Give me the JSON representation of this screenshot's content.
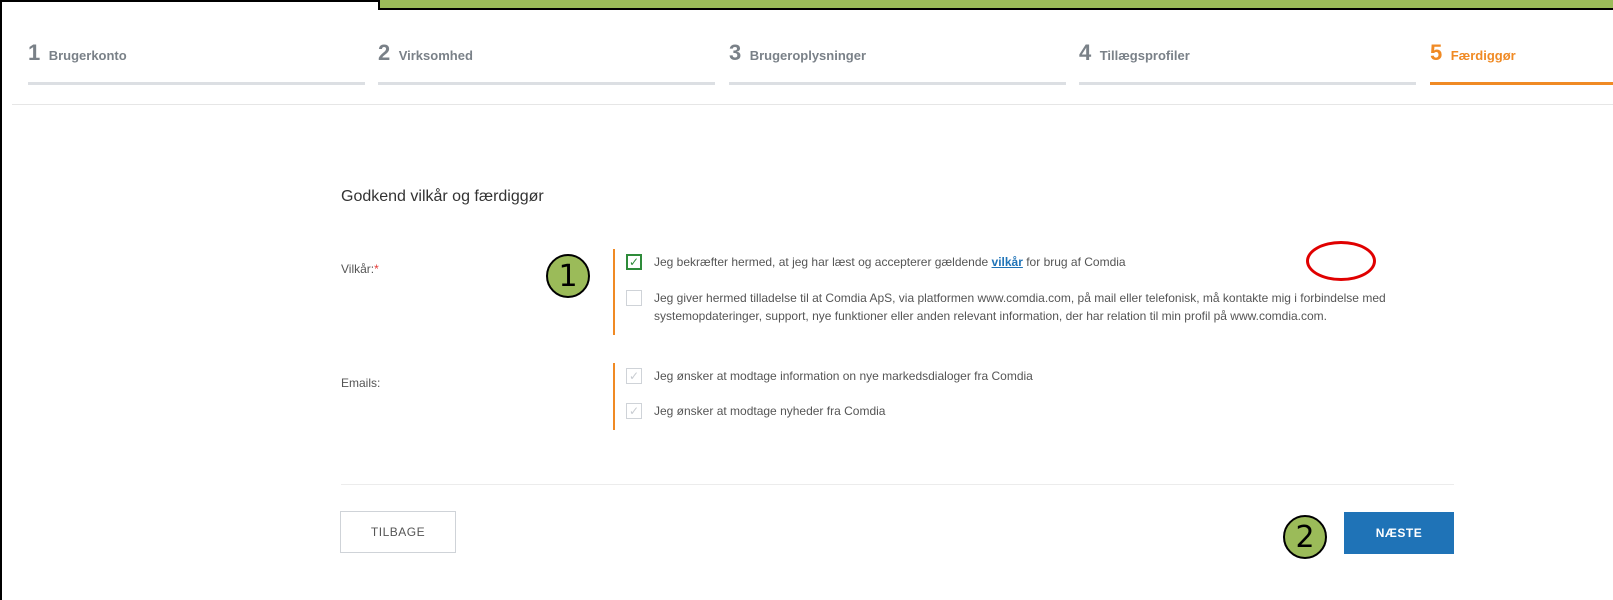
{
  "stepper": {
    "steps": [
      {
        "num": "1",
        "label": "Brugerkonto"
      },
      {
        "num": "2",
        "label": "Virksomhed"
      },
      {
        "num": "3",
        "label": "Brugeroplysninger"
      },
      {
        "num": "4",
        "label": "Tillægsprofiler"
      },
      {
        "num": "5",
        "label": "Færdiggør"
      }
    ],
    "active_step": 5
  },
  "form": {
    "title": "Godkend vilkår og færdiggør",
    "terms_label": "Vilkår:",
    "required_mark": "*",
    "terms": [
      {
        "text_before": "Jeg bekræfter hermed, at jeg har læst og accepterer gældende ",
        "link": "vilkår",
        "text_after": " for brug af Comdia",
        "checked": true
      },
      {
        "line1": "Jeg giver hermed tilladelse til at Comdia ApS, via platformen www.comdia.com, på mail eller telefonisk, må kontakte mig i forbindelse med",
        "line2": "systemopdateringer, support, nye funktioner eller anden relevant information, der har relation til min profil på www.comdia.com.",
        "checked": false
      }
    ],
    "emails_label": "Emails:",
    "emails": [
      {
        "text": "Jeg ønsker at modtage information on nye markedsdialoger fra Comdia",
        "checked": true
      },
      {
        "text": "Jeg ønsker at modtage nyheder fra Comdia",
        "checked": true
      }
    ]
  },
  "buttons": {
    "back": "TILBAGE",
    "next": "NÆSTE"
  },
  "annotations": {
    "badge1": "1",
    "badge2": "2"
  },
  "colors": {
    "accent_orange": "#f08a24",
    "primary_blue": "#1f73b7",
    "annotation_green": "#9bbb59",
    "highlight_red": "#e00000",
    "check_green": "#2e8b3a"
  }
}
